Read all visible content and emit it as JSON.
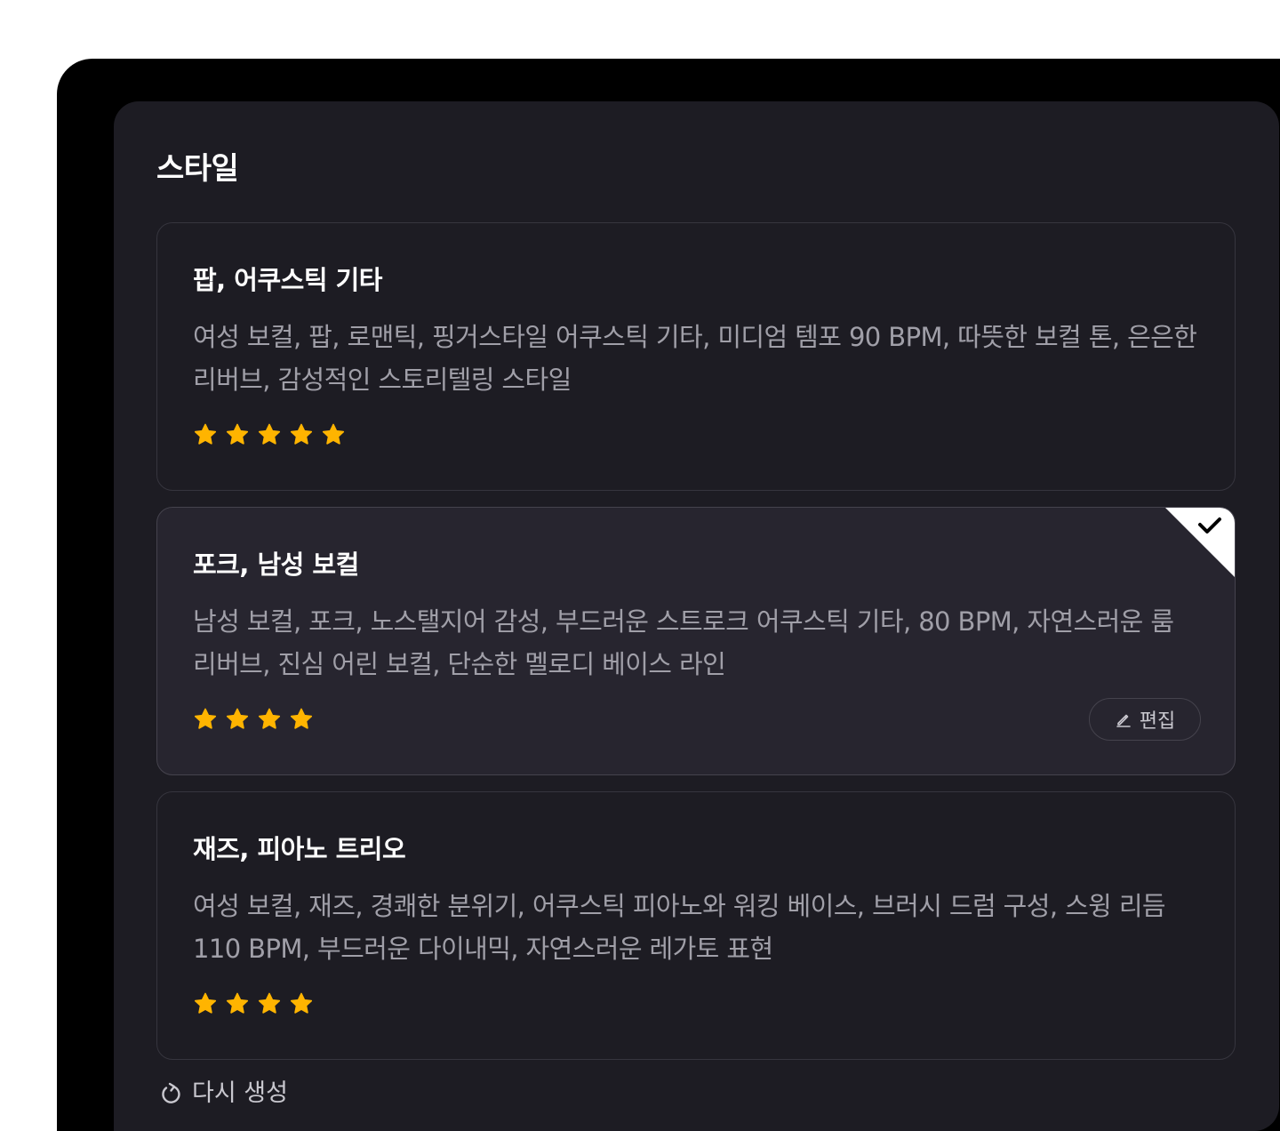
{
  "panel": {
    "title": "스타일"
  },
  "cards": [
    {
      "title": "팝, 어쿠스틱 기타",
      "description": "여성 보컬, 팝, 로맨틱, 핑거스타일 어쿠스틱 기타, 미디엄 템포 90 BPM, 따뜻한 보컬 톤, 은은한 리버브, 감성적인 스토리텔링 스타일",
      "rating": 5,
      "selected": false
    },
    {
      "title": "포크, 남성 보컬",
      "description": "남성 보컬, 포크, 노스탤지어 감성, 부드러운 스트로크 어쿠스틱 기타, 80 BPM, 자연스러운 룸 리버브, 진심 어린 보컬, 단순한 멜로디 베이스 라인",
      "rating": 4,
      "selected": true,
      "edit_label": "편집"
    },
    {
      "title": "재즈, 피아노 트리오",
      "description": "여성 보컬, 재즈, 경쾌한 분위기, 어쿠스틱 피아노와 워킹 베이스, 브러시 드럼 구성, 스윙 리듬 110 BPM, 부드러운 다이내믹, 자연스러운 레가토 표현",
      "rating": 4,
      "selected": false
    }
  ],
  "regenerate_label": "다시 생성",
  "colors": {
    "background": "#000000",
    "panel": "#1d1c23",
    "card_selected": "#27252f",
    "star": "#ffb400",
    "text_primary": "#ffffff",
    "text_secondary": "#a09fa8"
  }
}
